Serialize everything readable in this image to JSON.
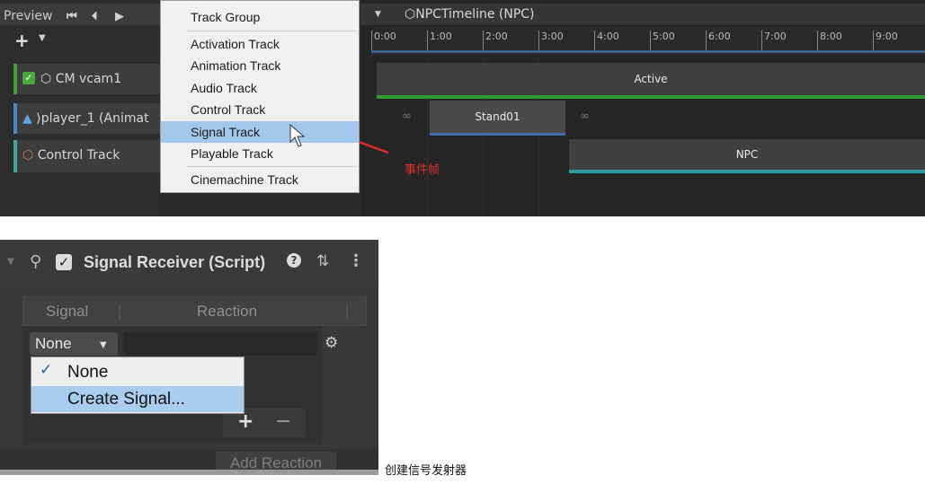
{
  "timeline": {
    "preview_label": "Preview",
    "title": "NPCTimeline (NPC)",
    "ruler_ticks": [
      "0:00",
      "1:00",
      "2:00",
      "3:00",
      "4:00",
      "5:00",
      "6:00",
      "7:00",
      "8:00",
      "9:00"
    ],
    "tracks": [
      {
        "label": "CM vcam1",
        "color": "#3ea034"
      },
      {
        "label": "player_1 (Animat",
        "color": "#4a86c8"
      },
      {
        "label": "Control Track",
        "color": "#3fa6a2"
      }
    ],
    "clips": {
      "active": "Active",
      "stand": "Stand01",
      "npc": "NPC"
    },
    "annotation": "事件帧"
  },
  "track_menu": {
    "items": [
      {
        "label": "Track Group",
        "selected": false
      },
      {
        "label": "Activation Track",
        "selected": false
      },
      {
        "label": "Animation Track",
        "selected": false
      },
      {
        "label": "Audio Track",
        "selected": false
      },
      {
        "label": "Control Track",
        "selected": false
      },
      {
        "label": "Signal Track",
        "selected": true
      },
      {
        "label": "Playable Track",
        "selected": false
      },
      {
        "label": "Cinemachine Track",
        "selected": false
      }
    ]
  },
  "inspector": {
    "title": "Signal Receiver (Script)",
    "col_signal": "Signal",
    "col_reaction": "Reaction",
    "dropdown_value": "None",
    "add_reaction": "Add Reaction",
    "plus": "+",
    "minus": "−"
  },
  "signal_menu": {
    "items": [
      {
        "label": "None",
        "checked": true
      },
      {
        "label": "Create Signal...",
        "checked": false
      }
    ]
  },
  "caption": "创建信号发射器",
  "colors": {
    "selection": "#a3c8ec",
    "annotation": "#e03030"
  }
}
